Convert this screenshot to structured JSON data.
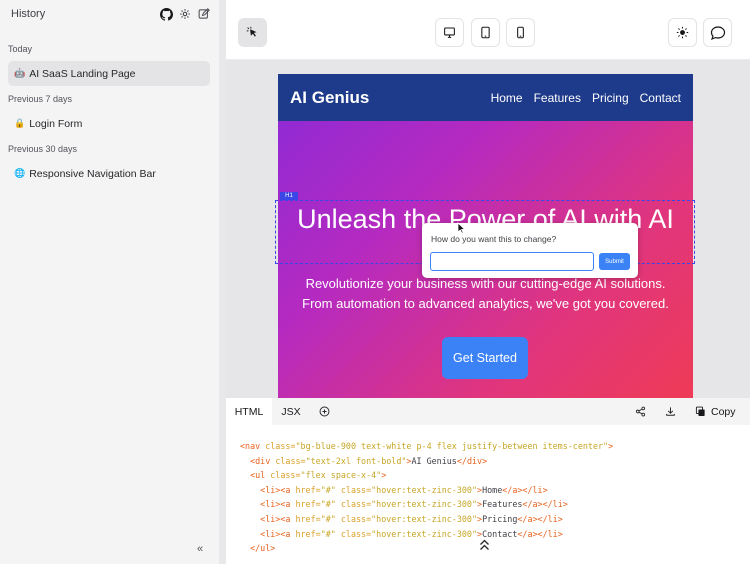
{
  "sidebar": {
    "title": "History",
    "groups": [
      {
        "label": "Today",
        "items": [
          {
            "emoji": "🤖",
            "label": "AI SaaS Landing Page",
            "active": true
          }
        ]
      },
      {
        "label": "Previous 7 days",
        "items": [
          {
            "emoji": "🔒",
            "label": "Login Form"
          }
        ]
      },
      {
        "label": "Previous 30 days",
        "items": [
          {
            "emoji": "🌐",
            "label": "Responsive Navigation Bar"
          }
        ]
      }
    ],
    "collapse_glyph": "«"
  },
  "icons": {
    "github": "github-icon",
    "settings": "gear-icon",
    "new": "edit-icon",
    "select": "pointer-select-icon",
    "desktop": "monitor-icon",
    "tablet": "tablet-icon",
    "mobile": "phone-icon",
    "theme": "sun-icon",
    "chat": "chat-bubble-icon",
    "share": "share-icon",
    "download": "download-icon",
    "copy": "copy-icon",
    "add_tab": "plus-circle-icon"
  },
  "preview": {
    "logo": "AI Genius",
    "nav_links": [
      "Home",
      "Features",
      "Pricing",
      "Contact"
    ],
    "hero_title": "Unleash the Power of AI with AI",
    "hero_sub_line1": "Revolutionize your business with our cutting-edge AI solutions.",
    "hero_sub_line2": "From automation to advanced analytics, we've got you covered.",
    "cta": "Get Started",
    "selection_tag": "H1"
  },
  "popover": {
    "question": "How do you want this to change?",
    "input_value": "",
    "submit": "Submit"
  },
  "code_panel": {
    "tabs": [
      "HTML",
      "JSX"
    ],
    "active_tab": "HTML",
    "copy_label": "Copy",
    "lines": [
      {
        "indent": "",
        "parts": [
          [
            "tg",
            "<nav "
          ],
          [
            "at",
            "class="
          ],
          [
            "st",
            "\"bg-blue-900 text-white p-4 flex justify-between items-center\""
          ],
          [
            "tg",
            ">"
          ]
        ]
      },
      {
        "indent": "  ",
        "parts": [
          [
            "tg",
            "<div "
          ],
          [
            "at",
            "class="
          ],
          [
            "st",
            "\"text-2xl font-bold\""
          ],
          [
            "tg",
            ">"
          ],
          [
            "tx",
            "AI Genius"
          ],
          [
            "tg",
            "</div>"
          ]
        ]
      },
      {
        "indent": "  ",
        "parts": [
          [
            "tg",
            "<ul "
          ],
          [
            "at",
            "class="
          ],
          [
            "st",
            "\"flex space-x-4\""
          ],
          [
            "tg",
            ">"
          ]
        ]
      },
      {
        "indent": "    ",
        "parts": [
          [
            "tg",
            "<li><a "
          ],
          [
            "at",
            "href="
          ],
          [
            "st",
            "\"#\" "
          ],
          [
            "at",
            "class="
          ],
          [
            "st",
            "\"hover:text-zinc-300\""
          ],
          [
            "tg",
            ">"
          ],
          [
            "tx",
            "Home"
          ],
          [
            "tg",
            "</a></li>"
          ]
        ]
      },
      {
        "indent": "    ",
        "parts": [
          [
            "tg",
            "<li><a "
          ],
          [
            "at",
            "href="
          ],
          [
            "st",
            "\"#\" "
          ],
          [
            "at",
            "class="
          ],
          [
            "st",
            "\"hover:text-zinc-300\""
          ],
          [
            "tg",
            ">"
          ],
          [
            "tx",
            "Features"
          ],
          [
            "tg",
            "</a></li>"
          ]
        ]
      },
      {
        "indent": "    ",
        "parts": [
          [
            "tg",
            "<li><a "
          ],
          [
            "at",
            "href="
          ],
          [
            "st",
            "\"#\" "
          ],
          [
            "at",
            "class="
          ],
          [
            "st",
            "\"hover:text-zinc-300\""
          ],
          [
            "tg",
            ">"
          ],
          [
            "tx",
            "Pricing"
          ],
          [
            "tg",
            "</a></li>"
          ]
        ]
      },
      {
        "indent": "    ",
        "parts": [
          [
            "tg",
            "<li><a "
          ],
          [
            "at",
            "href="
          ],
          [
            "st",
            "\"#\" "
          ],
          [
            "at",
            "class="
          ],
          [
            "st",
            "\"hover:text-zinc-300\""
          ],
          [
            "tg",
            ">"
          ],
          [
            "tx",
            "Contact"
          ],
          [
            "tg",
            "</a></li>"
          ]
        ]
      },
      {
        "indent": "  ",
        "parts": [
          [
            "tg",
            "</ul>"
          ]
        ]
      }
    ]
  },
  "colors": {
    "nav_bg": "#1e3a8a",
    "accent": "#3b82f6",
    "selection": "#3b46e6"
  }
}
